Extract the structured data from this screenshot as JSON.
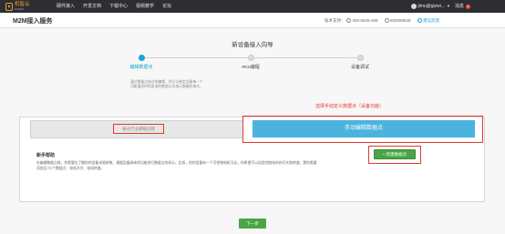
{
  "header": {
    "logo_text": "机智云",
    "logo_sub": "GizWits",
    "nav": [
      "硬件接入",
      "开发文档",
      "下载中心",
      "视频教学",
      "论坛"
    ],
    "user": "jlmu@gizwi...",
    "messages_label": "消息",
    "messages_count": "0"
  },
  "titlebar": {
    "title": "M2M接入服务",
    "support_label": "技术支持：",
    "phone": "400-6525-488",
    "qq": "800099639",
    "feedback": "建议反馈"
  },
  "wizard": {
    "title": "新设备接入向导",
    "steps": [
      "编辑数据点",
      "mcu编程",
      "设备调试"
    ],
    "active_step": 0,
    "description": "通过数据点协议的编辑，你可以制定设备每一个功能通讯时所发送的数据以及指示数据的格式。"
  },
  "panel": {
    "tab_left": "通过行业模板创建",
    "tab_right": "手动编辑数据点",
    "annotation": "选择手动定义数据点（设备功能）",
    "help_title": "新手帮助",
    "help_text": "在编辑数据点前，你需要先了解你的设备详细参数，根据设备具体的功能进行数据点的拆分。比如，你的设备有一个可控制电机马达，你希望可以远程控制电机的开关和转速，那你需要添加至少2个数据点：电机开关、电机转速。",
    "add_button": "+ 新建数据点"
  },
  "footer": {
    "next_button": "下一步"
  },
  "colors": {
    "accent": "#1aa3d6",
    "tab_active": "#4cb3de",
    "success": "#48a645",
    "highlight": "#e23a2e"
  }
}
